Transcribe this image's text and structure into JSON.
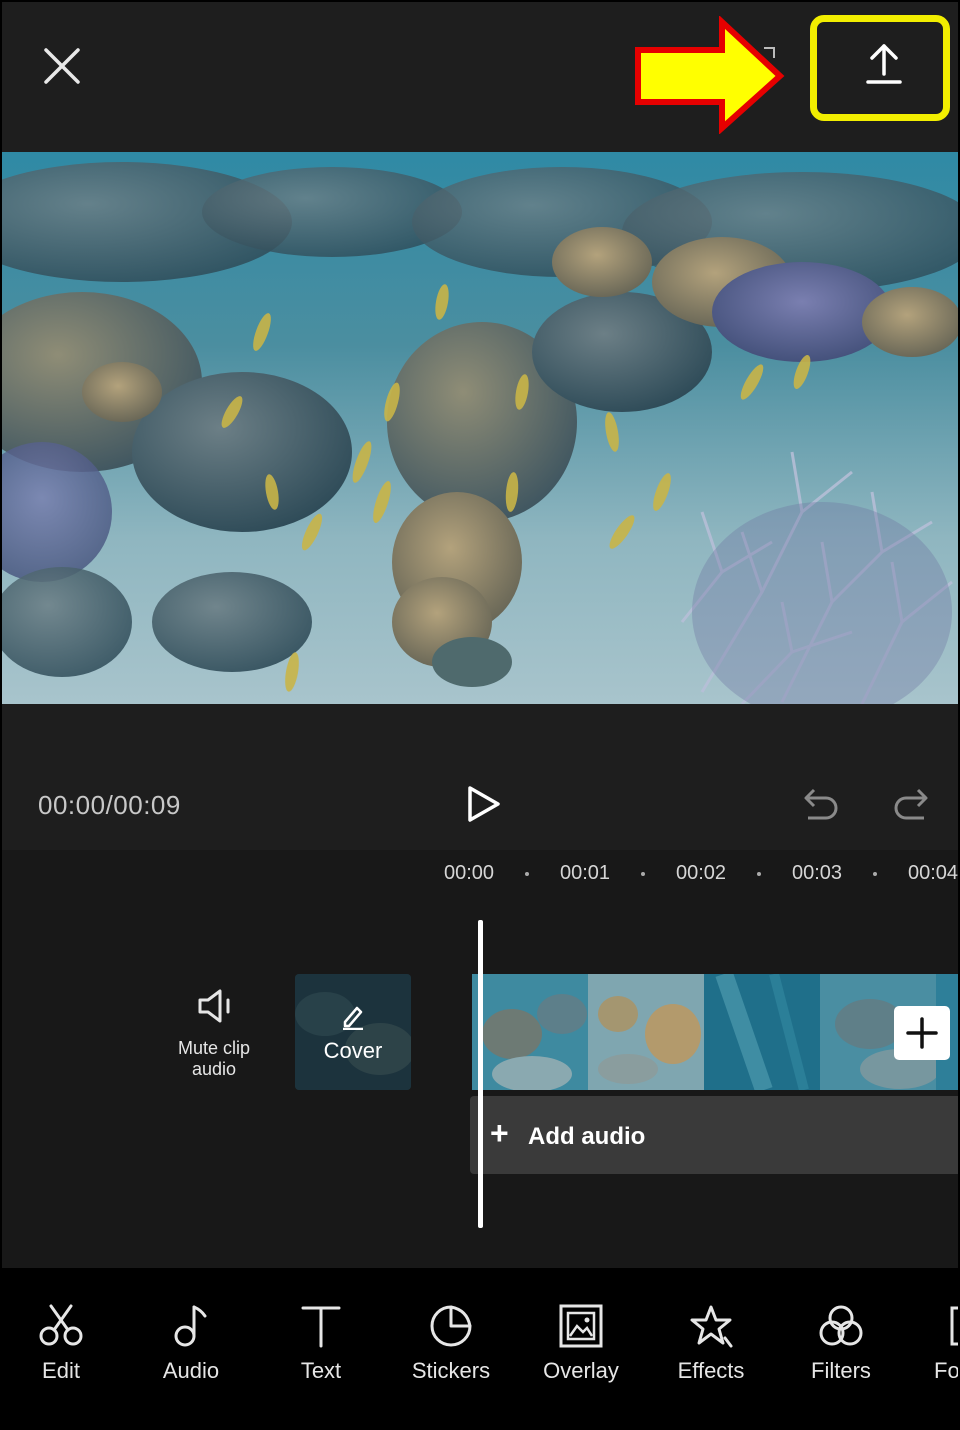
{
  "playback": {
    "timecode": "00:00/00:09"
  },
  "ruler": {
    "ticks": [
      "00:00",
      "00:01",
      "00:02",
      "00:03",
      "00:04"
    ]
  },
  "timeline": {
    "mute_label": "Mute clip\naudio",
    "cover_label": "Cover",
    "add_audio_label": "Add audio",
    "add_audio_plus": "+"
  },
  "toolbar": {
    "items": [
      {
        "label": "Edit",
        "icon": "scissors-icon"
      },
      {
        "label": "Audio",
        "icon": "music-note-icon"
      },
      {
        "label": "Text",
        "icon": "text-icon"
      },
      {
        "label": "Stickers",
        "icon": "sticker-icon"
      },
      {
        "label": "Overlay",
        "icon": "overlay-icon"
      },
      {
        "label": "Effects",
        "icon": "effects-star-icon"
      },
      {
        "label": "Filters",
        "icon": "filters-icon"
      },
      {
        "label": "Fo",
        "icon": "format-icon"
      }
    ]
  },
  "colors": {
    "highlight": "#f2ee00",
    "arrow_fill": "#ffff00",
    "arrow_stroke": "#e60000",
    "background": "#1e1e1e"
  }
}
